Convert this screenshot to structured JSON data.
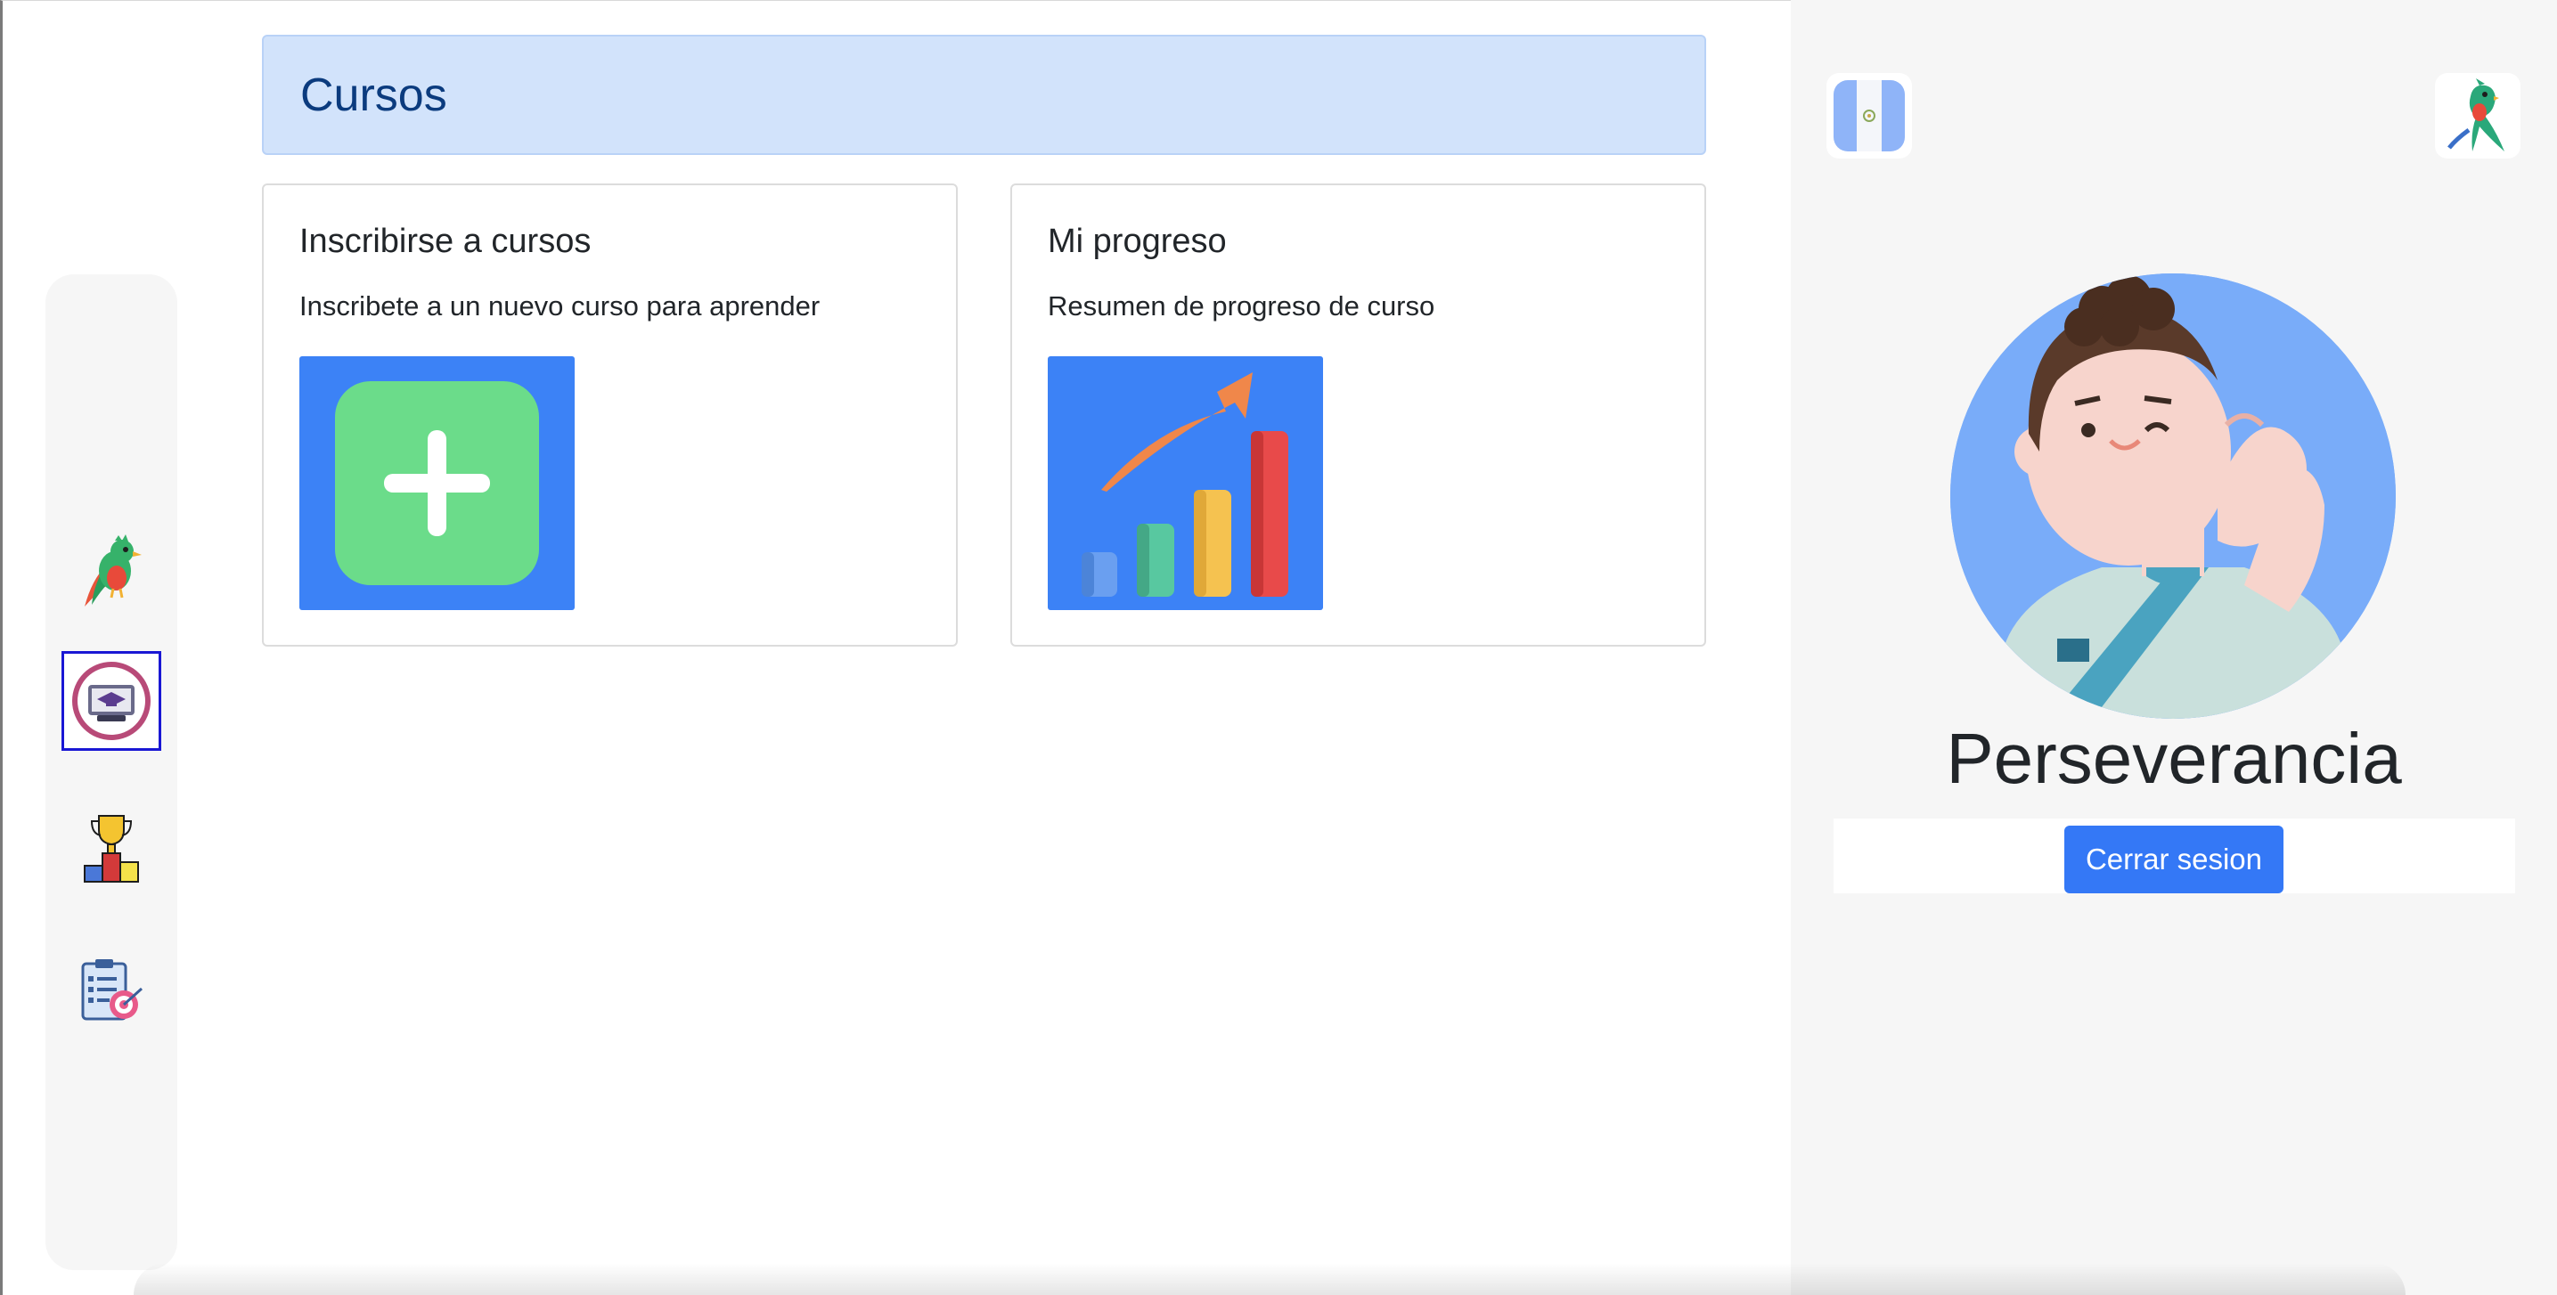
{
  "header": {
    "title": "Cursos"
  },
  "cards": [
    {
      "title": "Inscribirse a cursos",
      "description": "Inscribete a un nuevo curso para aprender",
      "icon": "add-course-icon"
    },
    {
      "title": "Mi progreso",
      "description": "Resumen de progreso de curso",
      "icon": "progress-chart-icon"
    }
  ],
  "sidebar": {
    "items": [
      {
        "icon": "quetzal-bird-icon",
        "active": false
      },
      {
        "icon": "graduation-cap-laptop-icon",
        "active": true
      },
      {
        "icon": "trophy-podium-icon",
        "active": false
      },
      {
        "icon": "clipboard-target-icon",
        "active": false
      }
    ]
  },
  "profile": {
    "username": "Perseverancia",
    "logout_label": "Cerrar sesion"
  },
  "colors": {
    "accent": "#3478f6",
    "header_bg": "#d2e3fb",
    "header_text": "#0b3b7e",
    "avatar_bg": "#79acf9"
  }
}
